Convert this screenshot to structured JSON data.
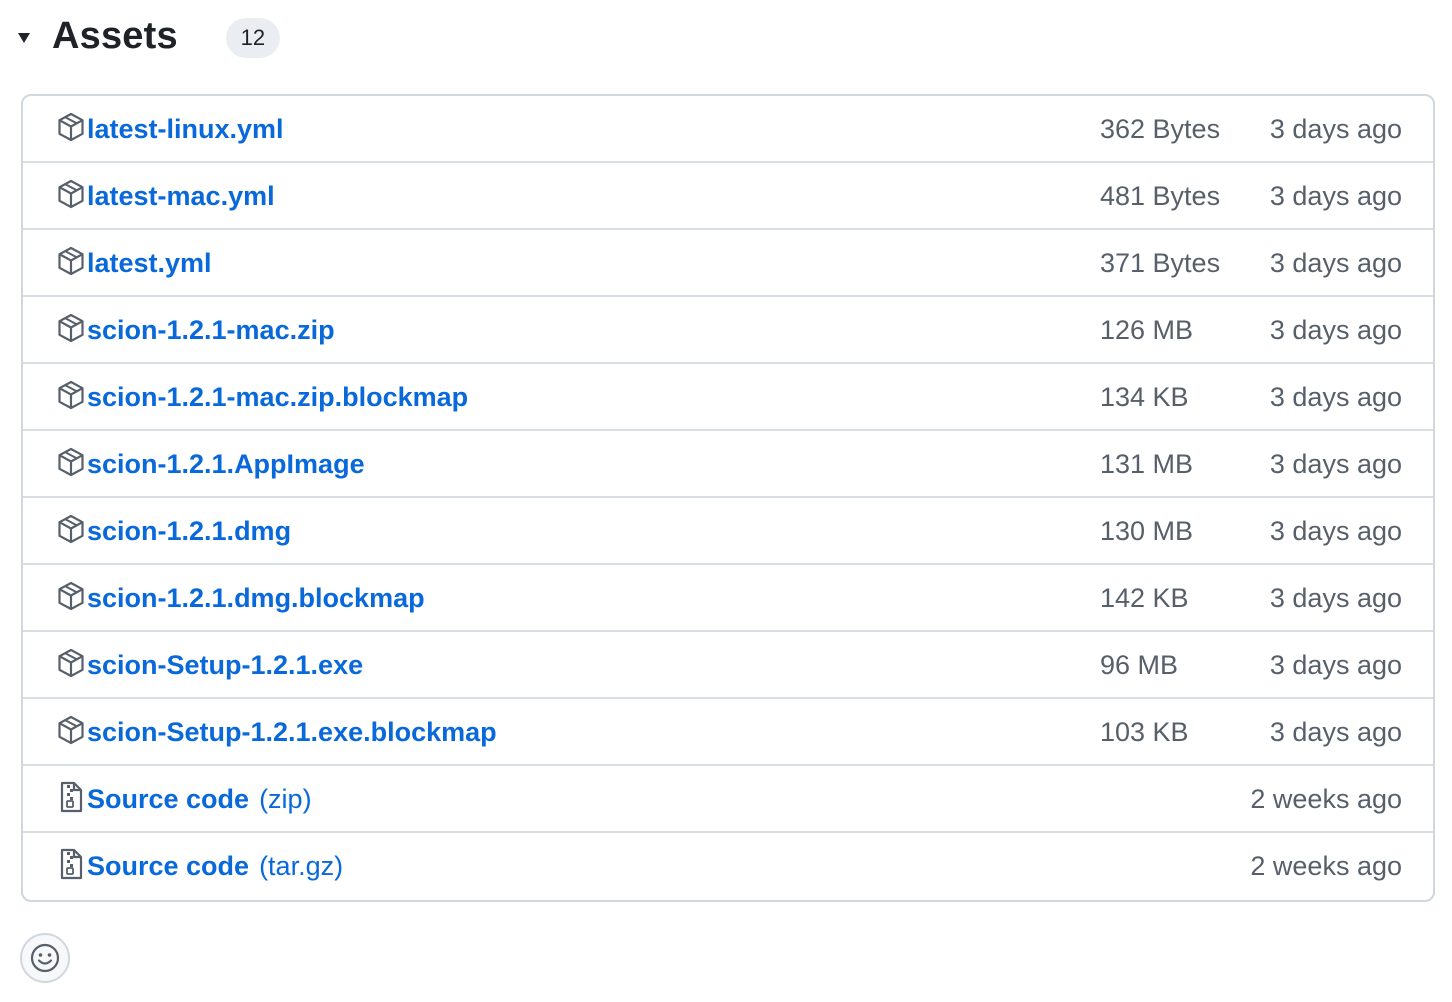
{
  "header": {
    "title": "Assets",
    "count": "12"
  },
  "assets": [
    {
      "name": "latest-linux.yml",
      "suffix": "",
      "size": "362 Bytes",
      "date": "3 days ago",
      "icon": "package-icon"
    },
    {
      "name": "latest-mac.yml",
      "suffix": "",
      "size": "481 Bytes",
      "date": "3 days ago",
      "icon": "package-icon"
    },
    {
      "name": "latest.yml",
      "suffix": "",
      "size": "371 Bytes",
      "date": "3 days ago",
      "icon": "package-icon"
    },
    {
      "name": "scion-1.2.1-mac.zip",
      "suffix": "",
      "size": "126 MB",
      "date": "3 days ago",
      "icon": "package-icon"
    },
    {
      "name": "scion-1.2.1-mac.zip.blockmap",
      "suffix": "",
      "size": "134 KB",
      "date": "3 days ago",
      "icon": "package-icon"
    },
    {
      "name": "scion-1.2.1.AppImage",
      "suffix": "",
      "size": "131 MB",
      "date": "3 days ago",
      "icon": "package-icon"
    },
    {
      "name": "scion-1.2.1.dmg",
      "suffix": "",
      "size": "130 MB",
      "date": "3 days ago",
      "icon": "package-icon"
    },
    {
      "name": "scion-1.2.1.dmg.blockmap",
      "suffix": "",
      "size": "142 KB",
      "date": "3 days ago",
      "icon": "package-icon"
    },
    {
      "name": "scion-Setup-1.2.1.exe",
      "suffix": "",
      "size": "96 MB",
      "date": "3 days ago",
      "icon": "package-icon"
    },
    {
      "name": "scion-Setup-1.2.1.exe.blockmap",
      "suffix": "",
      "size": "103 KB",
      "date": "3 days ago",
      "icon": "package-icon"
    },
    {
      "name": "Source code",
      "suffix": "(zip)",
      "size": "",
      "date": "2 weeks ago",
      "icon": "file-zip-icon"
    },
    {
      "name": "Source code",
      "suffix": "(tar.gz)",
      "size": "",
      "date": "2 weeks ago",
      "icon": "file-zip-icon"
    }
  ],
  "reaction": {
    "icon": "smiley-icon"
  },
  "colors": {
    "link": "#0969da",
    "muted": "#57606a",
    "border": "#d0d7de",
    "badge_bg": "#eaeef2"
  }
}
